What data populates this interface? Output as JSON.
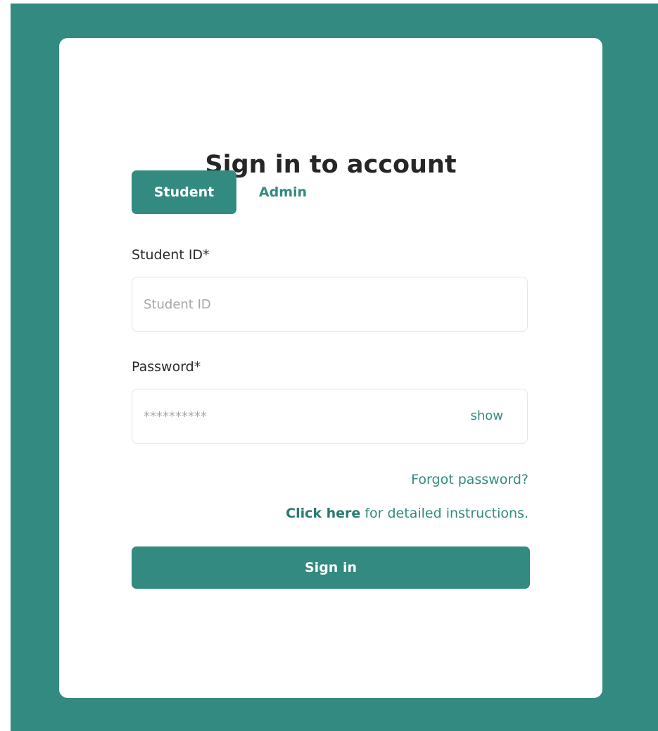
{
  "login": {
    "title": "Sign in to account",
    "tabs": [
      {
        "label": "Student",
        "active": true
      },
      {
        "label": "Admin",
        "active": false
      }
    ],
    "student_id": {
      "label": "Student ID*",
      "placeholder": "Student ID",
      "value": ""
    },
    "password": {
      "label": "Password*",
      "placeholder": "**********",
      "value": "",
      "toggle_label": "show"
    },
    "forgot_password_label": "Forgot password?",
    "instructions": {
      "link_label": "Click here",
      "suffix": " for detailed instructions."
    },
    "submit_label": "Sign in"
  },
  "colors": {
    "brand": "#338a80",
    "card_background": "#ffffff",
    "title_text": "#262626"
  }
}
